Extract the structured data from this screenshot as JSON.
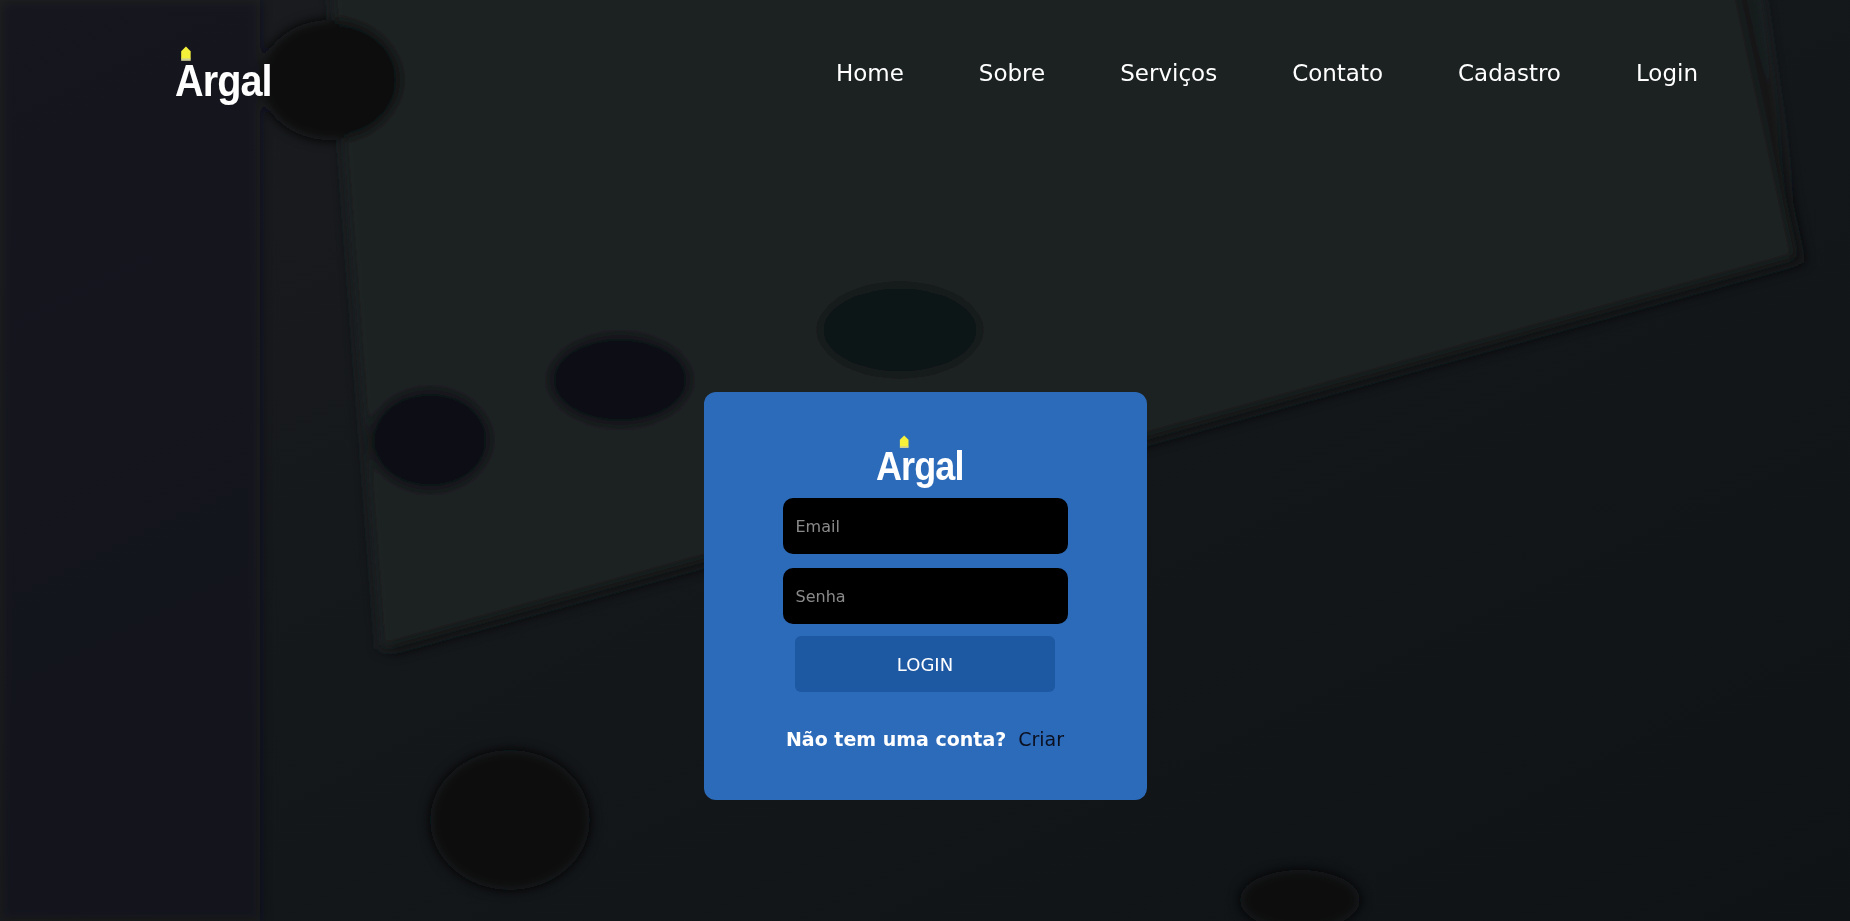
{
  "header": {
    "logo": "Argal",
    "nav": [
      {
        "label": "Home"
      },
      {
        "label": "Sobre"
      },
      {
        "label": "Serviços"
      },
      {
        "label": "Contato"
      },
      {
        "label": "Cadastro"
      },
      {
        "label": "Login"
      }
    ]
  },
  "login_card": {
    "logo": "Argal",
    "fields": [
      {
        "placeholder": "Email"
      },
      {
        "placeholder": "Senha"
      }
    ],
    "button": "LOGIN",
    "signup_prompt": "Não tem uma conta?",
    "signup_link": "Criar"
  }
}
